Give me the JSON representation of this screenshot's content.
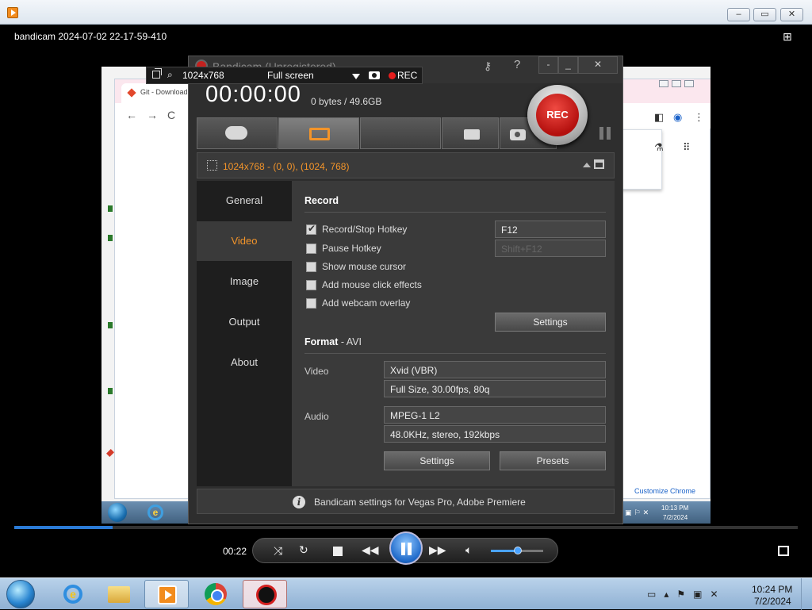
{
  "player": {
    "media_title": "bandicam 2024-07-02 22-17-59-410",
    "elapsed": "00:22",
    "progress_fraction": 0.125,
    "volume_fraction": 0.5,
    "window_buttons": [
      "–",
      "▭",
      "✕"
    ]
  },
  "browser": {
    "tab_title": "Git - Download",
    "customize_label": "Customize Chrome",
    "clock_time": "10:13 PM",
    "clock_date": "7/2/2024"
  },
  "capture_bar": {
    "size": "1024x768",
    "mode": "Full screen",
    "rec_label": "REC"
  },
  "bandicam": {
    "title": "Bandicam (Unregistered)",
    "controls": [
      "-",
      "_",
      "✕"
    ],
    "timer": "00:00:00",
    "filesize": "0 bytes / 49.6GB",
    "rec_button": "REC",
    "region_text": "1024x768 - (0, 0), (1024, 768)",
    "sidebar": [
      "General",
      "Video",
      "Image",
      "Output",
      "About"
    ],
    "active_sidebar": "Video",
    "record": {
      "title": "Record",
      "options": [
        {
          "label": "Record/Stop Hotkey",
          "checked": true
        },
        {
          "label": "Pause Hotkey",
          "checked": false
        },
        {
          "label": "Show mouse cursor",
          "checked": false
        },
        {
          "label": "Add mouse click effects",
          "checked": false
        },
        {
          "label": "Add webcam overlay",
          "checked": false
        }
      ],
      "record_hotkey": "F12",
      "pause_hotkey": "Shift+F12",
      "settings_label": "Settings"
    },
    "format": {
      "title": "Format",
      "container": " - AVI",
      "video_label": "Video",
      "video_codec": "Xvid (VBR)",
      "video_detail": "Full Size, 30.00fps, 80q",
      "audio_label": "Audio",
      "audio_codec": "MPEG-1 L2",
      "audio_detail": "48.0KHz, stereo, 192kbps",
      "settings_label": "Settings",
      "presets_label": "Presets"
    },
    "status_text": "Bandicam settings for Vegas Pro, Adobe Premiere"
  },
  "taskbar": {
    "clock_time": "10:24 PM",
    "clock_date": "7/2/2024"
  },
  "colors": {
    "accent_orange": "#f2942a",
    "rec_red": "#c3211f",
    "seek_blue": "#2b7bd6"
  }
}
